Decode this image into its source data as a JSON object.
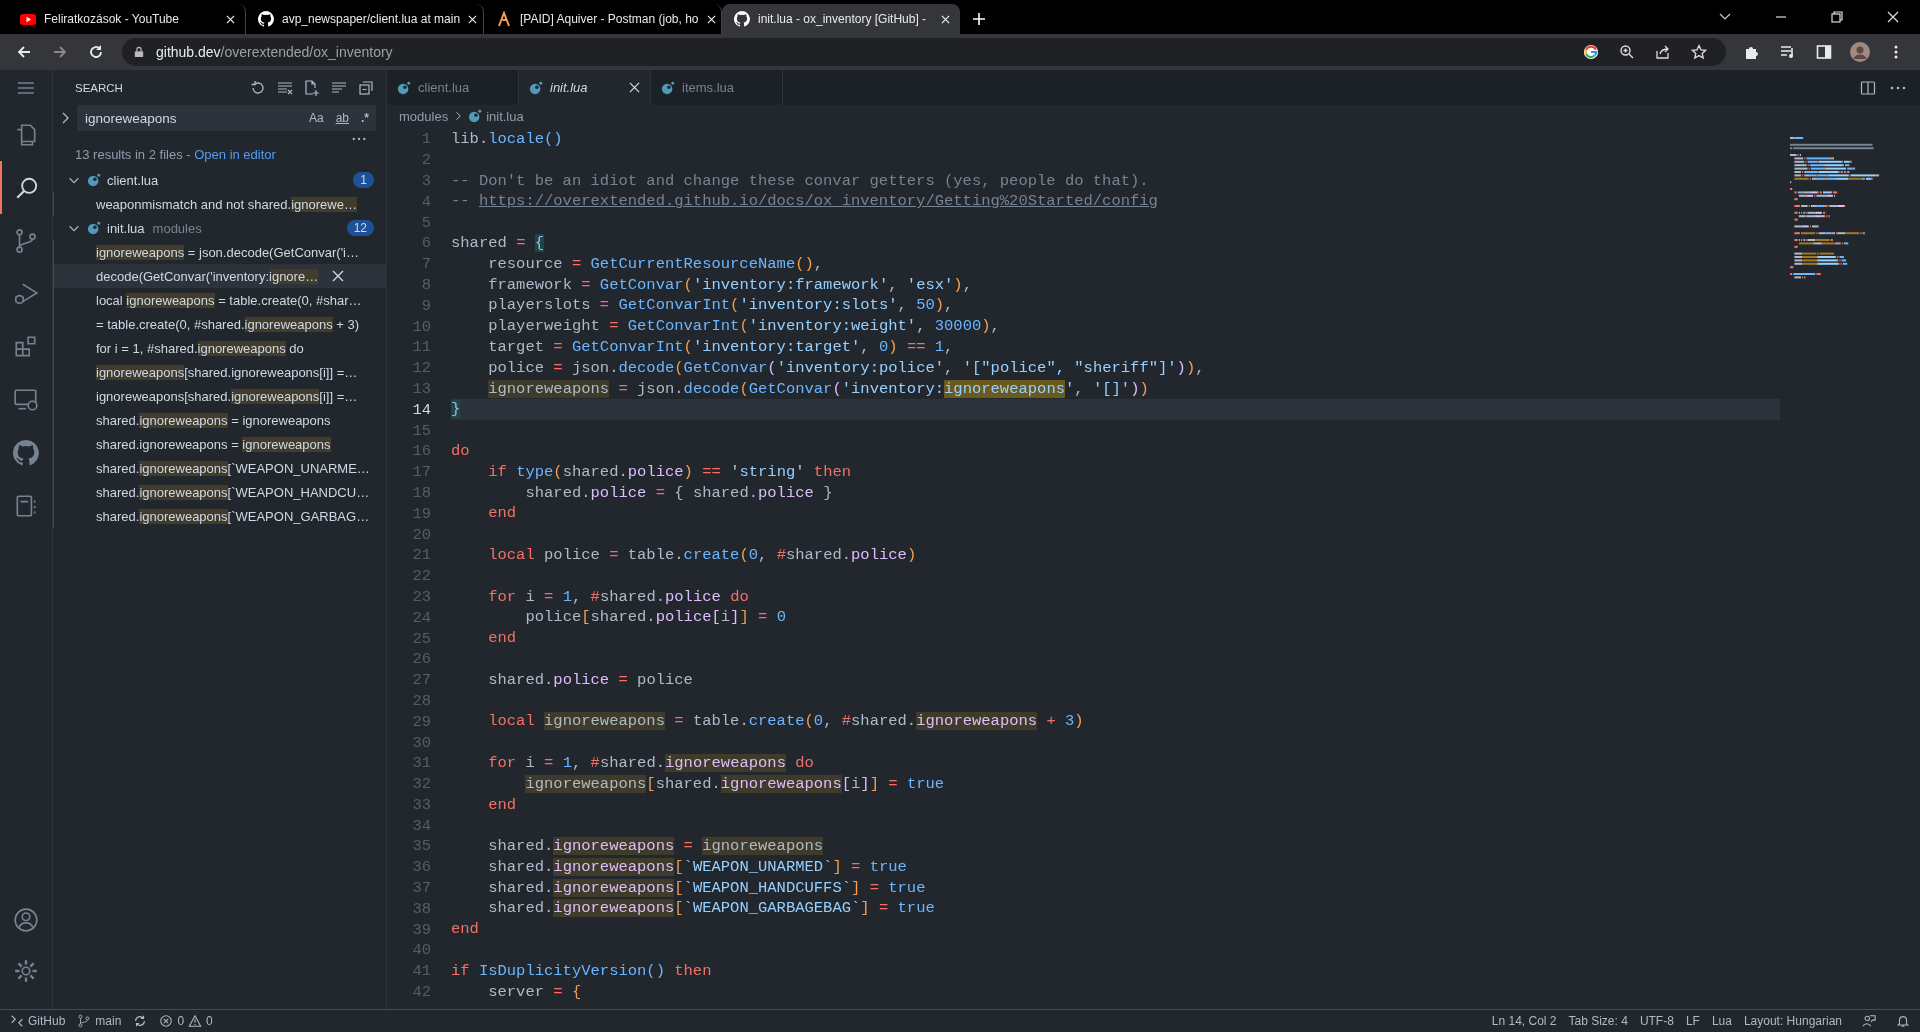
{
  "browser": {
    "tabs": [
      {
        "title": "Feliratkozások - YouTube",
        "kind": "youtube",
        "selected": false
      },
      {
        "title": "avp_newspaper/client.lua at main",
        "kind": "github",
        "selected": false
      },
      {
        "title": "[PAID] Aquiver - Postman (job, ho",
        "kind": "postman",
        "selected": false
      },
      {
        "title": "init.lua - ox_inventory [GitHub] -",
        "kind": "github",
        "selected": true
      }
    ],
    "address": {
      "host": "github.dev",
      "path": "/overextended/ox_inventory"
    }
  },
  "activity_bar": {
    "items": [
      {
        "kind": "explorer",
        "selected": false
      },
      {
        "kind": "search",
        "selected": true
      },
      {
        "kind": "source-control",
        "selected": false
      },
      {
        "kind": "run",
        "selected": false
      },
      {
        "kind": "extensions",
        "selected": false
      },
      {
        "kind": "remote",
        "selected": false
      },
      {
        "kind": "github",
        "selected": false
      },
      {
        "kind": "notebook",
        "selected": false
      }
    ]
  },
  "sidebar": {
    "title": "SEARCH",
    "query": "ignoreweapons",
    "options": [
      {
        "label": "Aa",
        "on": false
      },
      {
        "label": "ab",
        "on": false
      },
      {
        "label": ".*",
        "on": false
      }
    ],
    "summary": "13 results in 2 files - ",
    "summary_link": "Open in editor",
    "files": [
      {
        "name": "client.lua",
        "count": "1",
        "expanded": true,
        "results": [
          {
            "parts": [
              {
                "t": "weaponmismatch and not shared.",
                "hl": false
              },
              {
                "t": "ignorewe…",
                "hl": true
              }
            ],
            "selected": false
          }
        ]
      },
      {
        "name": "init.lua",
        "folder": "modules",
        "count": "12",
        "expanded": true,
        "results": [
          {
            "parts": [
              {
                "t": "ignoreweapons",
                "hl": true
              },
              {
                "t": " = json.decode(GetConvar('i…",
                "hl": false
              }
            ],
            "selected": false
          },
          {
            "parts": [
              {
                "t": "decode(GetConvar('inventory:",
                "hl": false
              },
              {
                "t": "ignore…",
                "hl": true
              }
            ],
            "selected": true
          },
          {
            "parts": [
              {
                "t": "local ",
                "hl": false
              },
              {
                "t": "ignoreweapons",
                "hl": true
              },
              {
                "t": " = table.create(0, #shar…",
                "hl": false
              }
            ],
            "selected": false
          },
          {
            "parts": [
              {
                "t": "= table.create(0, #shared.",
                "hl": false
              },
              {
                "t": "ignoreweapons",
                "hl": true
              },
              {
                "t": " + 3)",
                "hl": false
              }
            ],
            "selected": false
          },
          {
            "parts": [
              {
                "t": "for i = 1, #shared.",
                "hl": false
              },
              {
                "t": "ignoreweapons",
                "hl": true
              },
              {
                "t": " do",
                "hl": false
              }
            ],
            "selected": false
          },
          {
            "parts": [
              {
                "t": "ignoreweapons",
                "hl": true
              },
              {
                "t": "[shared.ignoreweapons[i]] =…",
                "hl": false
              }
            ],
            "selected": false
          },
          {
            "parts": [
              {
                "t": "ignoreweapons[shared.",
                "hl": false
              },
              {
                "t": "ignoreweapons",
                "hl": true
              },
              {
                "t": "[i]] =…",
                "hl": false
              }
            ],
            "selected": false
          },
          {
            "parts": [
              {
                "t": "shared.",
                "hl": false
              },
              {
                "t": "ignoreweapons",
                "hl": true
              },
              {
                "t": " = ignoreweapons",
                "hl": false
              }
            ],
            "selected": false
          },
          {
            "parts": [
              {
                "t": "shared.ignoreweapons = ",
                "hl": false
              },
              {
                "t": "ignoreweapons",
                "hl": true
              }
            ],
            "selected": false
          },
          {
            "parts": [
              {
                "t": "shared.",
                "hl": false
              },
              {
                "t": "ignoreweapons",
                "hl": true
              },
              {
                "t": "[`WEAPON_UNARME…",
                "hl": false
              }
            ],
            "selected": false
          },
          {
            "parts": [
              {
                "t": "shared.",
                "hl": false
              },
              {
                "t": "ignoreweapons",
                "hl": true
              },
              {
                "t": "[`WEAPON_HANDCU…",
                "hl": false
              }
            ],
            "selected": false
          },
          {
            "parts": [
              {
                "t": "shared.",
                "hl": false
              },
              {
                "t": "ignoreweapons",
                "hl": true
              },
              {
                "t": "[`WEAPON_GARBAG…",
                "hl": false
              }
            ],
            "selected": false
          }
        ]
      }
    ]
  },
  "editor": {
    "tabs": [
      {
        "label": "client.lua",
        "selected": false
      },
      {
        "label": "init.lua",
        "selected": true
      },
      {
        "label": "items.lua",
        "selected": false
      }
    ],
    "breadcrumb": [
      "modules",
      "init.lua"
    ],
    "lines": [
      {
        "n": "1",
        "tokens": [
          {
            "t": "lib.",
            "kind": "id"
          },
          {
            "t": "locale()",
            "kind": "fn"
          }
        ]
      },
      {
        "n": "2"
      },
      {
        "n": "3",
        "tokens": [
          {
            "t": "-- Don't be an idiot and change these convar getters (yes, people do that).",
            "kind": "cm"
          }
        ]
      },
      {
        "n": "4",
        "tokens": [
          {
            "t": "-- ",
            "kind": "cm"
          },
          {
            "t": "https://overextended.github.io/docs/ox_inventory/Getting%20Started/config",
            "kind": "link"
          }
        ]
      },
      {
        "n": "5"
      },
      {
        "n": "6",
        "tokens": [
          {
            "t": "shared ",
            "kind": "id"
          },
          {
            "t": "= ",
            "kind": "op"
          },
          {
            "t": "{",
            "kind": "brm"
          }
        ]
      },
      {
        "n": "7",
        "tokens": [
          {
            "t": "    resource ",
            "kind": "id"
          },
          {
            "t": "= ",
            "kind": "op"
          },
          {
            "t": "GetCurrentResourceName",
            "kind": "fn"
          },
          {
            "t": "()",
            "kind": "br"
          },
          {
            "t": ",",
            "kind": "id"
          }
        ]
      },
      {
        "n": "8",
        "tokens": [
          {
            "t": "    framework ",
            "kind": "id"
          },
          {
            "t": "= ",
            "kind": "op"
          },
          {
            "t": "GetConvar",
            "kind": "fn"
          },
          {
            "t": "(",
            "kind": "br"
          },
          {
            "t": "'inventory:framework'",
            "kind": "str"
          },
          {
            "t": ", ",
            "kind": "id"
          },
          {
            "t": "'esx'",
            "kind": "str"
          },
          {
            "t": ")",
            "kind": "br"
          },
          {
            "t": ",",
            "kind": "id"
          }
        ]
      },
      {
        "n": "9",
        "tokens": [
          {
            "t": "    playerslots ",
            "kind": "id"
          },
          {
            "t": "= ",
            "kind": "op"
          },
          {
            "t": "GetConvarInt",
            "kind": "fn"
          },
          {
            "t": "(",
            "kind": "br"
          },
          {
            "t": "'inventory:slots'",
            "kind": "str"
          },
          {
            "t": ", ",
            "kind": "id"
          },
          {
            "t": "50",
            "kind": "num"
          },
          {
            "t": ")",
            "kind": "br"
          },
          {
            "t": ",",
            "kind": "id"
          }
        ]
      },
      {
        "n": "10",
        "tokens": [
          {
            "t": "    playerweight ",
            "kind": "id"
          },
          {
            "t": "= ",
            "kind": "op"
          },
          {
            "t": "GetConvarInt",
            "kind": "fn"
          },
          {
            "t": "(",
            "kind": "br"
          },
          {
            "t": "'inventory:weight'",
            "kind": "str"
          },
          {
            "t": ", ",
            "kind": "id"
          },
          {
            "t": "30000",
            "kind": "num"
          },
          {
            "t": ")",
            "kind": "br"
          },
          {
            "t": ",",
            "kind": "id"
          }
        ]
      },
      {
        "n": "11",
        "tokens": [
          {
            "t": "    target ",
            "kind": "id"
          },
          {
            "t": "= ",
            "kind": "op"
          },
          {
            "t": "GetConvarInt",
            "kind": "fn"
          },
          {
            "t": "(",
            "kind": "br"
          },
          {
            "t": "'inventory:target'",
            "kind": "str"
          },
          {
            "t": ", ",
            "kind": "id"
          },
          {
            "t": "0",
            "kind": "num"
          },
          {
            "t": ")",
            "kind": "br"
          },
          {
            "t": " == ",
            "kind": "op"
          },
          {
            "t": "1",
            "kind": "num"
          },
          {
            "t": ",",
            "kind": "id"
          }
        ]
      },
      {
        "n": "12",
        "tokens": [
          {
            "t": "    police ",
            "kind": "id"
          },
          {
            "t": "= ",
            "kind": "op"
          },
          {
            "t": "json.",
            "kind": "id"
          },
          {
            "t": "decode",
            "kind": "fn"
          },
          {
            "t": "(",
            "kind": "br"
          },
          {
            "t": "GetConvar",
            "kind": "fn"
          },
          {
            "t": "(",
            "kind": "br2"
          },
          {
            "t": "'inventory:police'",
            "kind": "str"
          },
          {
            "t": ", ",
            "kind": "id"
          },
          {
            "t": "'[\"police\", \"sheriff\"]'",
            "kind": "str"
          },
          {
            "t": ")",
            "kind": "br2"
          },
          {
            "t": ")",
            "kind": "br"
          },
          {
            "t": ",",
            "kind": "id"
          }
        ]
      },
      {
        "n": "13",
        "tokens": [
          {
            "t": "    ignoreweapons",
            "kind": "id",
            "match": true
          },
          {
            "t": " = ",
            "kind": "op"
          },
          {
            "t": "json.",
            "kind": "id"
          },
          {
            "t": "decode",
            "kind": "fn"
          },
          {
            "t": "(",
            "kind": "br"
          },
          {
            "t": "GetConvar",
            "kind": "fn"
          },
          {
            "t": "(",
            "kind": "br2"
          },
          {
            "t": "'inventory:",
            "kind": "str"
          },
          {
            "t": "ignoreweapons",
            "kind": "str",
            "current": true
          },
          {
            "t": "'",
            "kind": "str"
          },
          {
            "t": ", ",
            "kind": "id"
          },
          {
            "t": "'[]'",
            "kind": "str"
          },
          {
            "t": ")",
            "kind": "br2"
          },
          {
            "t": ")",
            "kind": "br"
          }
        ]
      },
      {
        "n": "14",
        "current": true,
        "tokens": [
          {
            "t": "}",
            "kind": "brm"
          }
        ]
      },
      {
        "n": "15"
      },
      {
        "n": "16",
        "tokens": [
          {
            "t": "do",
            "kind": "kw"
          }
        ]
      },
      {
        "n": "17",
        "tokens": [
          {
            "t": "    if ",
            "kind": "kw"
          },
          {
            "t": "type",
            "kind": "fn"
          },
          {
            "t": "(",
            "kind": "br"
          },
          {
            "t": "shared.",
            "kind": "id"
          },
          {
            "t": "police",
            "kind": "prop"
          },
          {
            "t": ")",
            "kind": "br"
          },
          {
            "t": " == ",
            "kind": "op"
          },
          {
            "t": "'string'",
            "kind": "str"
          },
          {
            "t": " then",
            "kind": "kw"
          }
        ]
      },
      {
        "n": "18",
        "tokens": [
          {
            "t": "        shared.",
            "kind": "id"
          },
          {
            "t": "police",
            "kind": "prop"
          },
          {
            "t": " = ",
            "kind": "op"
          },
          {
            "t": "{ shared.",
            "kind": "id"
          },
          {
            "t": "police",
            "kind": "prop"
          },
          {
            "t": " }",
            "kind": "id"
          }
        ]
      },
      {
        "n": "19",
        "tokens": [
          {
            "t": "    end",
            "kind": "kw"
          }
        ]
      },
      {
        "n": "20"
      },
      {
        "n": "21",
        "tokens": [
          {
            "t": "    local ",
            "kind": "kw"
          },
          {
            "t": "police ",
            "kind": "id"
          },
          {
            "t": "= ",
            "kind": "op"
          },
          {
            "t": "table.",
            "kind": "id"
          },
          {
            "t": "create",
            "kind": "fn"
          },
          {
            "t": "(",
            "kind": "br"
          },
          {
            "t": "0",
            "kind": "num"
          },
          {
            "t": ", ",
            "kind": "id"
          },
          {
            "t": "#",
            "kind": "op"
          },
          {
            "t": "shared.",
            "kind": "id"
          },
          {
            "t": "police",
            "kind": "prop"
          },
          {
            "t": ")",
            "kind": "br"
          }
        ]
      },
      {
        "n": "22"
      },
      {
        "n": "23",
        "tokens": [
          {
            "t": "    for ",
            "kind": "kw"
          },
          {
            "t": "i ",
            "kind": "id"
          },
          {
            "t": "= ",
            "kind": "op"
          },
          {
            "t": "1",
            "kind": "num"
          },
          {
            "t": ", ",
            "kind": "id"
          },
          {
            "t": "#",
            "kind": "op"
          },
          {
            "t": "shared.",
            "kind": "id"
          },
          {
            "t": "police",
            "kind": "prop"
          },
          {
            "t": " do",
            "kind": "kw"
          }
        ]
      },
      {
        "n": "24",
        "tokens": [
          {
            "t": "        police",
            "kind": "id"
          },
          {
            "t": "[",
            "kind": "br"
          },
          {
            "t": "shared.",
            "kind": "id"
          },
          {
            "t": "police",
            "kind": "prop"
          },
          {
            "t": "[",
            "kind": "br2"
          },
          {
            "t": "i",
            "kind": "id"
          },
          {
            "t": "]",
            "kind": "br2"
          },
          {
            "t": "]",
            "kind": "br"
          },
          {
            "t": " = ",
            "kind": "op"
          },
          {
            "t": "0",
            "kind": "num"
          }
        ]
      },
      {
        "n": "25",
        "tokens": [
          {
            "t": "    end",
            "kind": "kw"
          }
        ]
      },
      {
        "n": "26"
      },
      {
        "n": "27",
        "tokens": [
          {
            "t": "    shared.",
            "kind": "id"
          },
          {
            "t": "police",
            "kind": "prop"
          },
          {
            "t": " = ",
            "kind": "op"
          },
          {
            "t": "police",
            "kind": "id"
          }
        ]
      },
      {
        "n": "28"
      },
      {
        "n": "29",
        "tokens": [
          {
            "t": "    local ",
            "kind": "kw"
          },
          {
            "t": "ignoreweapons",
            "kind": "id",
            "match": true
          },
          {
            "t": " = ",
            "kind": "op"
          },
          {
            "t": "table.",
            "kind": "id"
          },
          {
            "t": "create",
            "kind": "fn"
          },
          {
            "t": "(",
            "kind": "br"
          },
          {
            "t": "0",
            "kind": "num"
          },
          {
            "t": ", ",
            "kind": "id"
          },
          {
            "t": "#",
            "kind": "op"
          },
          {
            "t": "shared.",
            "kind": "id"
          },
          {
            "t": "ignoreweapons",
            "kind": "prop",
            "match": true
          },
          {
            "t": " + ",
            "kind": "op"
          },
          {
            "t": "3",
            "kind": "num"
          },
          {
            "t": ")",
            "kind": "br"
          }
        ]
      },
      {
        "n": "30"
      },
      {
        "n": "31",
        "tokens": [
          {
            "t": "    for ",
            "kind": "kw"
          },
          {
            "t": "i ",
            "kind": "id"
          },
          {
            "t": "= ",
            "kind": "op"
          },
          {
            "t": "1",
            "kind": "num"
          },
          {
            "t": ", ",
            "kind": "id"
          },
          {
            "t": "#",
            "kind": "op"
          },
          {
            "t": "shared.",
            "kind": "id"
          },
          {
            "t": "ignoreweapons",
            "kind": "prop",
            "match": true
          },
          {
            "t": " do",
            "kind": "kw"
          }
        ]
      },
      {
        "n": "32",
        "tokens": [
          {
            "t": "        ignoreweapons",
            "kind": "id",
            "match": true
          },
          {
            "t": "[",
            "kind": "br"
          },
          {
            "t": "shared.",
            "kind": "id"
          },
          {
            "t": "ignoreweapons",
            "kind": "prop",
            "match": true
          },
          {
            "t": "[",
            "kind": "br2"
          },
          {
            "t": "i",
            "kind": "id"
          },
          {
            "t": "]",
            "kind": "br2"
          },
          {
            "t": "]",
            "kind": "br"
          },
          {
            "t": " = ",
            "kind": "op"
          },
          {
            "t": "true",
            "kind": "num"
          }
        ]
      },
      {
        "n": "33",
        "tokens": [
          {
            "t": "    end",
            "kind": "kw"
          }
        ]
      },
      {
        "n": "34"
      },
      {
        "n": "35",
        "tokens": [
          {
            "t": "    shared.",
            "kind": "id"
          },
          {
            "t": "ignoreweapons",
            "kind": "prop",
            "match": true
          },
          {
            "t": " = ",
            "kind": "op"
          },
          {
            "t": "ignoreweapons",
            "kind": "id",
            "match": true
          }
        ]
      },
      {
        "n": "36",
        "tokens": [
          {
            "t": "    shared.",
            "kind": "id"
          },
          {
            "t": "ignoreweapons",
            "kind": "prop",
            "match": true
          },
          {
            "t": "[",
            "kind": "br"
          },
          {
            "t": "`WEAPON_UNARMED`",
            "kind": "str"
          },
          {
            "t": "]",
            "kind": "br"
          },
          {
            "t": " = ",
            "kind": "op"
          },
          {
            "t": "true",
            "kind": "num"
          }
        ]
      },
      {
        "n": "37",
        "tokens": [
          {
            "t": "    shared.",
            "kind": "id"
          },
          {
            "t": "ignoreweapons",
            "kind": "prop",
            "match": true
          },
          {
            "t": "[",
            "kind": "br"
          },
          {
            "t": "`WEAPON_HANDCUFFS`",
            "kind": "str"
          },
          {
            "t": "]",
            "kind": "br"
          },
          {
            "t": " = ",
            "kind": "op"
          },
          {
            "t": "true",
            "kind": "num"
          }
        ]
      },
      {
        "n": "38",
        "tokens": [
          {
            "t": "    shared.",
            "kind": "id"
          },
          {
            "t": "ignoreweapons",
            "kind": "prop",
            "match": true
          },
          {
            "t": "[",
            "kind": "br"
          },
          {
            "t": "`WEAPON_GARBAGEBAG`",
            "kind": "str"
          },
          {
            "t": "]",
            "kind": "br"
          },
          {
            "t": " = ",
            "kind": "op"
          },
          {
            "t": "true",
            "kind": "num"
          }
        ]
      },
      {
        "n": "39",
        "tokens": [
          {
            "t": "end",
            "kind": "kw"
          }
        ]
      },
      {
        "n": "40"
      },
      {
        "n": "41",
        "tokens": [
          {
            "t": "if ",
            "kind": "kw"
          },
          {
            "t": "IsDuplicityVersion",
            "kind": "fn"
          },
          {
            "t": "()",
            "kind": "fn"
          },
          {
            "t": " then",
            "kind": "kw"
          }
        ]
      },
      {
        "n": "42",
        "tokens": [
          {
            "t": "    server ",
            "kind": "id"
          },
          {
            "t": "= ",
            "kind": "op"
          },
          {
            "t": "{",
            "kind": "br"
          }
        ]
      }
    ]
  },
  "status_bar": {
    "remote": "GitHub",
    "branch": "main",
    "errors": "0",
    "warnings": "0",
    "right": [
      "Ln 14, Col 2",
      "Tab Size: 4",
      "UTF-8",
      "LF",
      "Lua",
      "Layout: Hungarian"
    ]
  }
}
